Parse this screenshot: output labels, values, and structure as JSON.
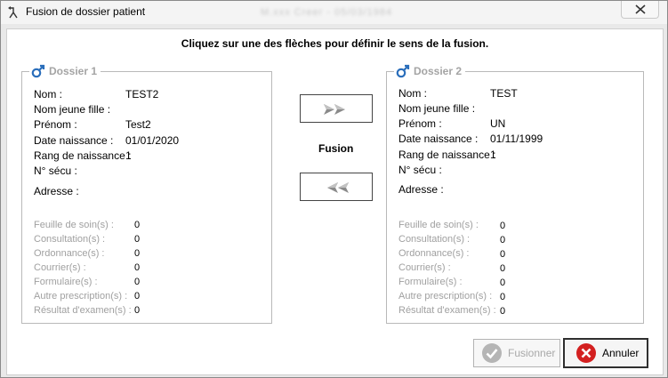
{
  "window": {
    "title": "Fusion de dossier patient",
    "title_blurred": "M.xxx Creer - 05/03/1984"
  },
  "instruction": "Cliquez sur une des flèches pour définir le sens de la fusion.",
  "dossier1": {
    "legend": "Dossier 1",
    "fields": {
      "nom_label": "Nom :",
      "nom_value": "TEST2",
      "nom_jeune_fille_label": "Nom jeune fille :",
      "nom_jeune_fille_value": "",
      "prenom_label": "Prénom :",
      "prenom_value": "Test2",
      "date_naissance_label": "Date naissance  :",
      "date_naissance_value": "01/01/2020",
      "rang_label": "Rang de naissance :",
      "rang_value": "1",
      "secu_label": "N° sécu :",
      "secu_value": "",
      "adresse_label": "Adresse :",
      "adresse_value": ""
    },
    "stats": [
      {
        "label": "Feuille de soin(s) :",
        "value": "0"
      },
      {
        "label": "Consultation(s) :",
        "value": "0"
      },
      {
        "label": "Ordonnance(s) :",
        "value": "0"
      },
      {
        "label": "Courrier(s) :",
        "value": "0"
      },
      {
        "label": "Formulaire(s) :",
        "value": "0"
      },
      {
        "label": "Autre prescription(s) :",
        "value": "0"
      },
      {
        "label": "Résultat d'examen(s) :",
        "value": "0"
      }
    ]
  },
  "dossier2": {
    "legend": "Dossier 2",
    "fields": {
      "nom_label": "Nom :",
      "nom_value": "TEST",
      "nom_jeune_fille_label": "Nom jeune fille :",
      "nom_jeune_fille_value": "",
      "prenom_label": "Prénom :",
      "prenom_value": "UN",
      "date_naissance_label": "Date naissance  :",
      "date_naissance_value": "01/11/1999",
      "rang_label": "Rang de naissance :",
      "rang_value": "1",
      "secu_label": "N° sécu :",
      "secu_value": "",
      "adresse_label": "Adresse :",
      "adresse_value": ""
    },
    "stats": [
      {
        "label": "Feuille de soin(s) :",
        "value": "0"
      },
      {
        "label": "Consultation(s) :",
        "value": "0"
      },
      {
        "label": "Ordonnance(s) :",
        "value": "0"
      },
      {
        "label": "Courrier(s) :",
        "value": "0"
      },
      {
        "label": "Formulaire(s) :",
        "value": "0"
      },
      {
        "label": "Autre prescription(s) :",
        "value": "0"
      },
      {
        "label": "Résultat d'examen(s) :",
        "value": "0"
      }
    ]
  },
  "fusion_label": "Fusion",
  "buttons": {
    "fusionner": "Fusionner",
    "annuler": "Annuler"
  },
  "icons": {
    "title": "merge-icon",
    "close": "close-icon",
    "male": "male-icon",
    "arrow_right": "double-arrow-right-icon",
    "arrow_left": "double-arrow-left-icon",
    "check": "check-icon",
    "cancel": "cancel-icon"
  },
  "colors": {
    "male_icon": "#2a6ebb",
    "cancel_red": "#d32020",
    "disabled_check": "#b5b5b5"
  }
}
